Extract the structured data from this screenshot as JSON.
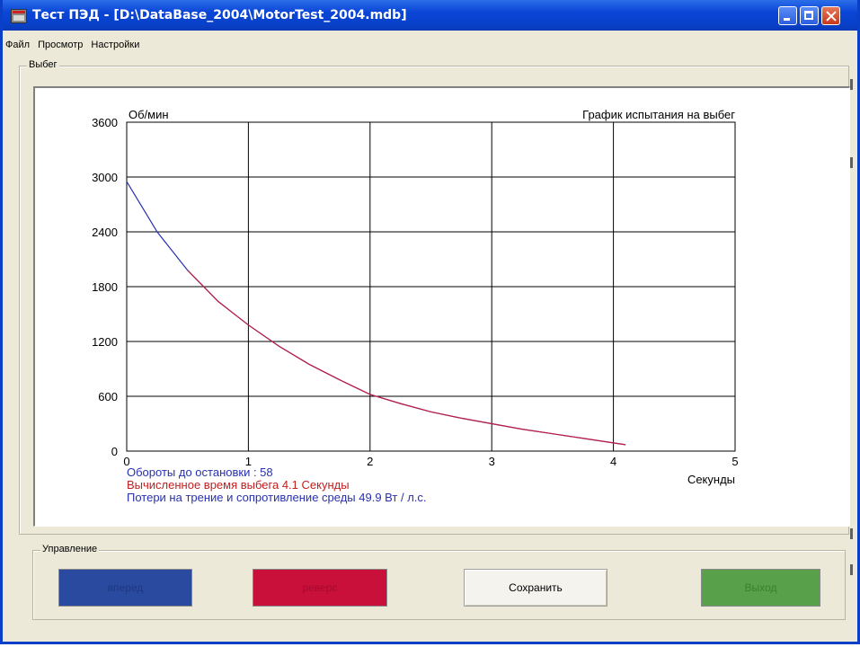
{
  "window": {
    "title": "Тест ПЭД - [D:\\DataBase_2004\\MotorTest_2004.mdb]",
    "icon": "app-motor-icon",
    "title_bar_color": "#0a45d6",
    "controls": {
      "minimize": "minimize-icon",
      "maximize": "maximize-icon",
      "close": "close-icon"
    }
  },
  "menu": [
    "Файл",
    "Просмотр",
    "Настройки"
  ],
  "run_group": {
    "label": "Выбег",
    "chart_data": {
      "type": "line",
      "title": "График испытания на выбег",
      "ylabel": "Об/мин",
      "xlabel": "Секунды",
      "xlim": [
        0,
        5
      ],
      "ylim": [
        0,
        3600
      ],
      "xticks": [
        "0",
        "1",
        "2",
        "3",
        "4",
        "5"
      ],
      "yticks": [
        "0",
        "600",
        "1200",
        "1800",
        "2400",
        "3000",
        "3600"
      ],
      "grid": true,
      "series": [
        {
          "color": "#2830b0",
          "x": [
            0,
            0.25,
            0.5,
            0.75,
            1,
            1.25,
            1.5,
            1.75,
            2,
            2.25,
            2.5,
            2.75,
            3,
            3.25,
            3.5,
            3.75,
            4,
            4.1
          ],
          "y": [
            2950,
            2400,
            1980,
            1640,
            1380,
            1150,
            950,
            780,
            620,
            520,
            430,
            360,
            300,
            240,
            190,
            140,
            90,
            70
          ]
        },
        {
          "color": "#c02040",
          "x": [
            0.5,
            0.75,
            1,
            1.25,
            1.5,
            1.75,
            2,
            2.25,
            2.5,
            2.75,
            3,
            3.25,
            3.5,
            3.75,
            4,
            4.1
          ],
          "y": [
            1980,
            1640,
            1380,
            1150,
            950,
            780,
            620,
            520,
            430,
            360,
            300,
            240,
            190,
            140,
            90,
            70
          ]
        }
      ]
    },
    "info": {
      "revolutions": "Обороты до остановки  :  58",
      "runout_time": "Вычисленное время выбега  4.1 Секунды",
      "friction_loss": "Потери на трение и сопротивление среды    49.9  Вт / л.с.",
      "revolutions_color": "#2830b0",
      "runout_time_color": "#c02020",
      "friction_loss_color": "#2830b0"
    }
  },
  "control_group": {
    "label": "Управление",
    "buttons": {
      "forward": "вперед",
      "reverse": "реверс",
      "save": "Сохранить",
      "exit": "Выход"
    },
    "colors": {
      "forward": "#2a4aa0",
      "reverse": "#c8103a",
      "save": "#f4f3ee",
      "exit": "#58a04a"
    }
  }
}
